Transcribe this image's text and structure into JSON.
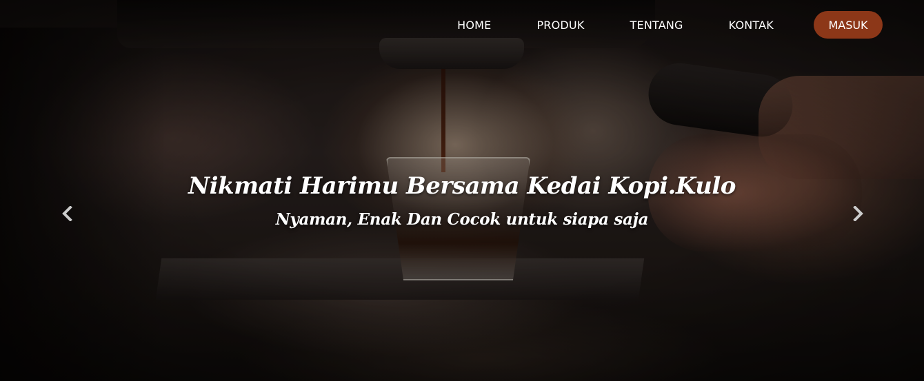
{
  "nav": {
    "items": [
      {
        "label": "HOME"
      },
      {
        "label": "PRODUK"
      },
      {
        "label": "TENTANG"
      },
      {
        "label": "KONTAK"
      }
    ],
    "login_label": "MASUK"
  },
  "hero": {
    "title": "Nikmati Harimu Bersama Kedai Kopi.Kulo",
    "subtitle": "Nyaman, Enak Dan Cocok untuk siapa saja",
    "background_image": "coffee-machine-espresso-photo"
  },
  "carousel": {
    "prev_icon": "chevron-left-icon",
    "next_icon": "chevron-right-icon"
  },
  "colors": {
    "accent": "#8c3718",
    "text": "#ffffff",
    "arrow": "#cccccc"
  }
}
